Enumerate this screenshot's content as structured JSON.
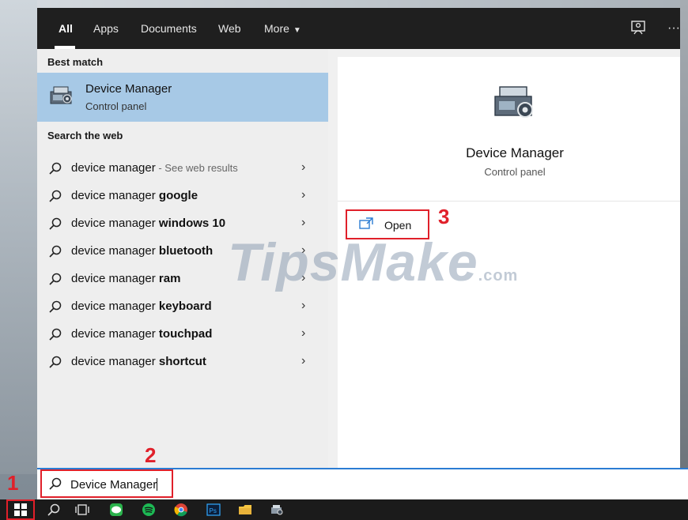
{
  "tabs": [
    {
      "label": "All",
      "active": true
    },
    {
      "label": "Apps"
    },
    {
      "label": "Documents"
    },
    {
      "label": "Web"
    },
    {
      "label": "More"
    }
  ],
  "toolbar": {
    "feedback_icon": "feedback-icon",
    "more_glyph": "···"
  },
  "best_match": {
    "section_label": "Best match",
    "title": "Device Manager",
    "subtitle": "Control panel"
  },
  "search_web": {
    "section_label": "Search the web",
    "items": [
      {
        "prefix": "device manager",
        "bold": "",
        "hint": " - See web results"
      },
      {
        "prefix": "device manager ",
        "bold": "google",
        "hint": ""
      },
      {
        "prefix": "device manager ",
        "bold": "windows 10",
        "hint": ""
      },
      {
        "prefix": "device manager ",
        "bold": "bluetooth",
        "hint": ""
      },
      {
        "prefix": "device manager ",
        "bold": "ram",
        "hint": ""
      },
      {
        "prefix": "device manager ",
        "bold": "keyboard",
        "hint": ""
      },
      {
        "prefix": "device manager ",
        "bold": "touchpad",
        "hint": ""
      },
      {
        "prefix": "device manager ",
        "bold": "shortcut",
        "hint": ""
      }
    ],
    "chevron": "›"
  },
  "detail": {
    "title": "Device Manager",
    "subtitle": "Control panel",
    "open_label": "Open"
  },
  "search_box": {
    "value": "Device Manager"
  },
  "steps": {
    "one": "1",
    "two": "2",
    "three": "3"
  },
  "watermark": {
    "main": "TipsMake",
    "suffix": ".com"
  },
  "colors": {
    "accent": "#2b7cd3",
    "highlight": "#e0202a",
    "selection": "#a7c9e6"
  }
}
